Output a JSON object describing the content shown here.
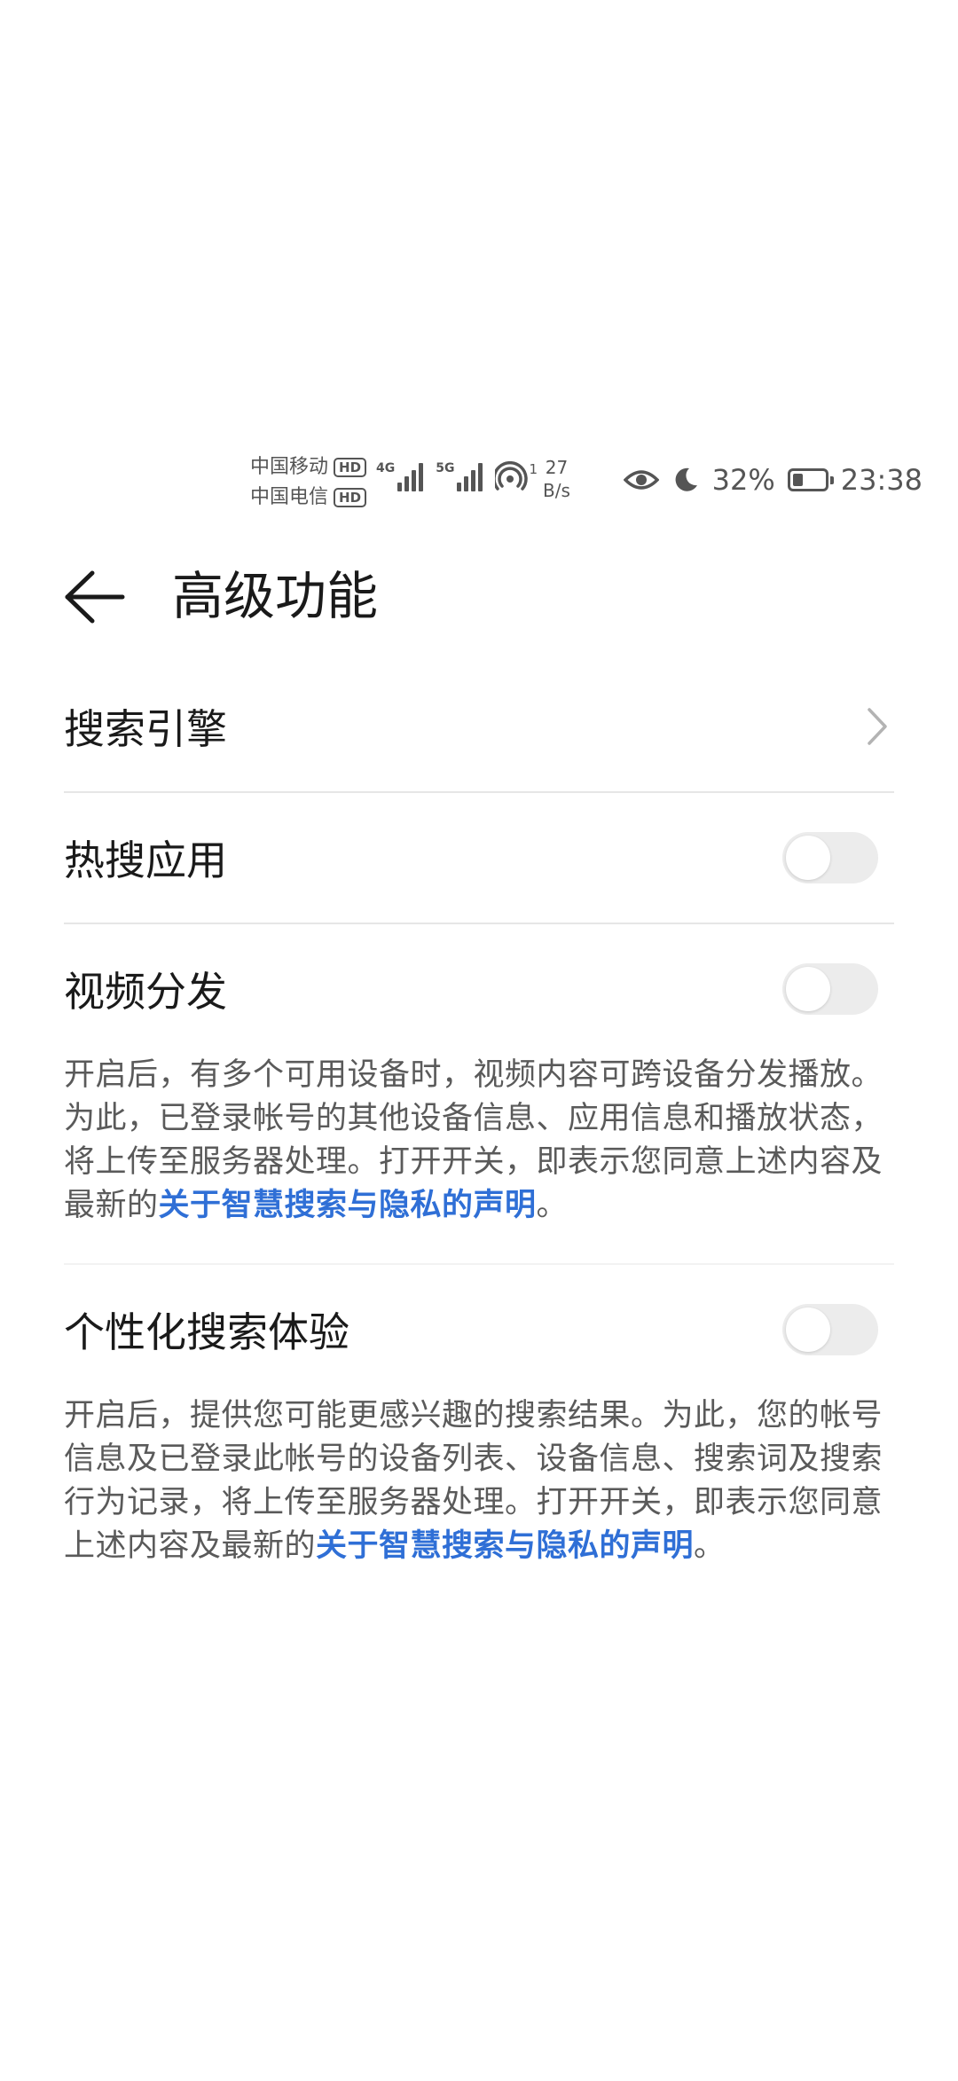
{
  "status_bar": {
    "carrier_1": "中国移动",
    "carrier_2": "中国电信",
    "hd_badge": "HD",
    "net_1": "4G",
    "net_2": "5G",
    "hotspot_count": "1",
    "speed_value": "27",
    "speed_unit": "B/s",
    "battery_percent": "32%",
    "battery_level": 0.32,
    "time": "23:38",
    "icons": [
      "eye-icon",
      "moon-icon",
      "battery-icon"
    ]
  },
  "header": {
    "title": "高级功能",
    "back_icon": "back-arrow-icon"
  },
  "items": {
    "search_engine": {
      "label": "搜索引擎"
    },
    "hot_search_apps": {
      "label": "热搜应用",
      "enabled": false
    },
    "video_distribution": {
      "label": "视频分发",
      "enabled": false,
      "description": "开启后，有多个可用设备时，视频内容可跨设备分发播放。为此，已登录帐号的其他设备信息、应用信息和播放状态，将上传至服务器处理。打开开关，即表示您同意上述内容及最新的",
      "link": "关于智慧搜索与隐私的声明",
      "suffix": "。"
    },
    "personalized_search": {
      "label": "个性化搜索体验",
      "enabled": false,
      "description": "开启后，提供您可能更感兴趣的搜索结果。为此，您的帐号信息及已登录此帐号的设备列表、设备信息、搜索词及搜索行为记录，将上传至服务器处理。打开开关，即表示您同意上述内容及最新的",
      "link": "关于智慧搜索与隐私的声明",
      "suffix": "。"
    }
  },
  "colors": {
    "link": "#2f6fd6",
    "toggle_off": "#ececec",
    "divider": "#e6e6e6"
  }
}
